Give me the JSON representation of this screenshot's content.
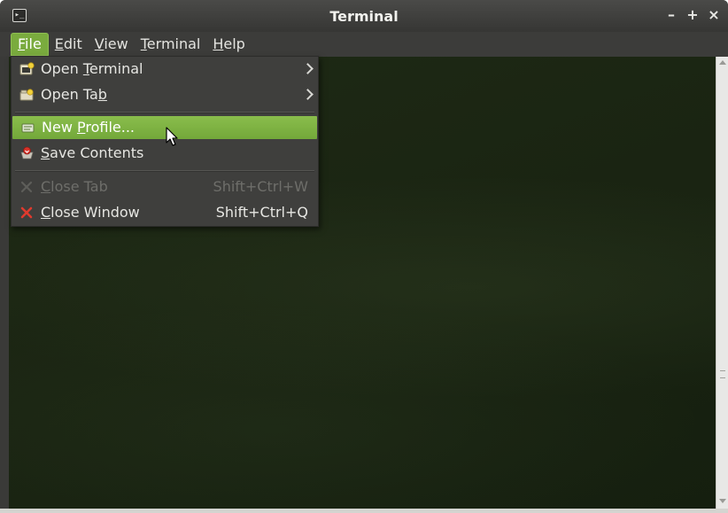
{
  "window": {
    "title": "Terminal",
    "title_icon_glyph": "▸_",
    "controls": {
      "minimize": "–",
      "maximize": "+",
      "close": "×"
    }
  },
  "menubar": {
    "items": [
      {
        "id": "file",
        "label": "File",
        "mnemonic": "F",
        "rest": "ile",
        "active": true
      },
      {
        "id": "edit",
        "label": "Edit",
        "mnemonic": "E",
        "rest": "dit",
        "active": false
      },
      {
        "id": "view",
        "label": "View",
        "mnemonic": "V",
        "rest": "iew",
        "active": false
      },
      {
        "id": "terminal",
        "label": "Terminal",
        "mnemonic": "T",
        "rest": "erminal",
        "active": false
      },
      {
        "id": "help",
        "label": "Help",
        "mnemonic": "H",
        "rest": "elp",
        "active": false
      }
    ]
  },
  "file_menu": {
    "items": [
      {
        "id": "open-terminal",
        "pre": "Open ",
        "mnemonic": "T",
        "post": "erminal",
        "accel": "",
        "submenu": true,
        "icon": "new-terminal-icon",
        "state": "normal"
      },
      {
        "id": "open-tab",
        "pre": "Open Ta",
        "mnemonic": "b",
        "post": "",
        "accel": "",
        "submenu": true,
        "icon": "new-tab-icon",
        "state": "normal"
      },
      {
        "id": "new-profile",
        "pre": "New ",
        "mnemonic": "P",
        "post": "rofile...",
        "accel": "",
        "submenu": false,
        "icon": "profile-icon",
        "state": "highlighted"
      },
      {
        "id": "save-contents",
        "pre": "",
        "mnemonic": "S",
        "post": "ave Contents",
        "accel": "",
        "submenu": false,
        "icon": "save-icon",
        "state": "normal"
      },
      {
        "id": "close-tab",
        "pre": "",
        "mnemonic": "C",
        "post": "lose Tab",
        "accel": "Shift+Ctrl+W",
        "submenu": false,
        "icon": "close-tab-icon",
        "state": "disabled"
      },
      {
        "id": "close-window",
        "pre": "",
        "mnemonic": "C",
        "post": "lose Window",
        "accel": "Shift+Ctrl+Q",
        "submenu": false,
        "icon": "close-window-icon",
        "state": "normal"
      }
    ]
  },
  "colors": {
    "menu_highlight": "#7aab3e",
    "terminal_background": "#1c2613",
    "close_icon_red": "#e03a2e"
  }
}
